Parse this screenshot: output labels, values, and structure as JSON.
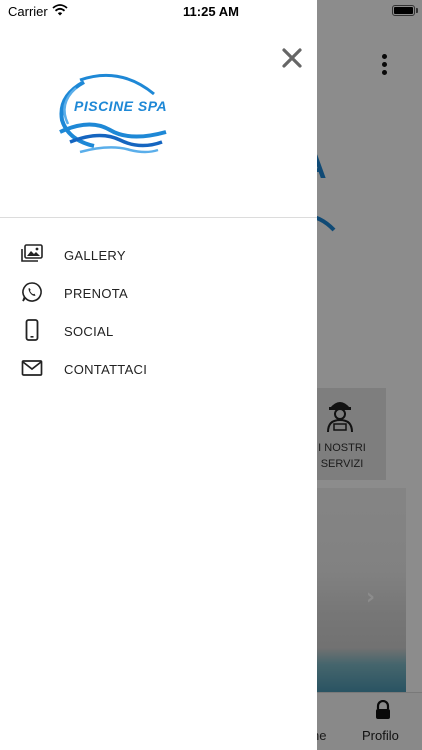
{
  "status_bar": {
    "carrier": "Carrier",
    "time": "11:25 AM",
    "battery_level": 1.0
  },
  "drawer": {
    "logo_text": "PISCINE SPA",
    "menu": [
      {
        "label": "GALLERY",
        "icon": "gallery-icon"
      },
      {
        "label": "PRENOTA",
        "icon": "whatsapp-icon"
      },
      {
        "label": "SOCIAL",
        "icon": "smartphone-icon"
      },
      {
        "label": "CONTATTACI",
        "icon": "envelope-icon"
      }
    ],
    "close_icon": "close-icon"
  },
  "background": {
    "logo_fragment": "A",
    "card_label": "I NOSTRI SERVIZI",
    "card_icon": "worker-icon",
    "tabs": {
      "left_fragment": "ne",
      "profile_label": "Profilo",
      "profile_icon": "lock-icon"
    }
  },
  "colors": {
    "brand_blue": "#1e88d6",
    "overlay": "#7a7a7a"
  }
}
